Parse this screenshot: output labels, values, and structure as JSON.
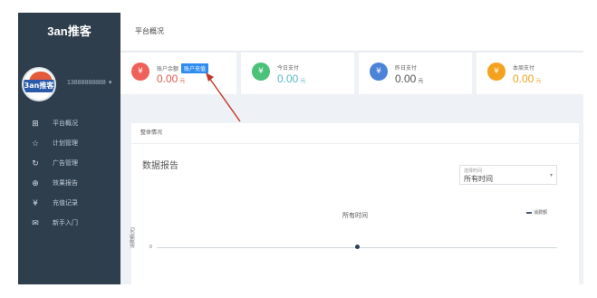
{
  "sidebar": {
    "brand": "3an推客",
    "avatar_text": "3an推客",
    "username": "13888888888",
    "items": [
      {
        "icon": "grid-icon",
        "glyph": "⊞",
        "label": "平台概况"
      },
      {
        "icon": "star-icon",
        "glyph": "☆",
        "label": "计划管理"
      },
      {
        "icon": "refresh-icon",
        "glyph": "↻",
        "label": "广告管理"
      },
      {
        "icon": "globe-icon",
        "glyph": "⊕",
        "label": "效果报告"
      },
      {
        "icon": "wallet-icon",
        "glyph": "¥",
        "label": "充值记录"
      },
      {
        "icon": "mail-icon",
        "glyph": "✉",
        "label": "新手入门"
      }
    ]
  },
  "header": {
    "title": "平台概况"
  },
  "cards": [
    {
      "label": "账户余额",
      "amount": "0.00",
      "unit": "元",
      "color": "#f0605a",
      "amount_color": "#e2594f",
      "icon": "yen-icon",
      "glyph": "¥",
      "button": "账户充值"
    },
    {
      "label": "今日支付",
      "amount": "0.00",
      "unit": "元",
      "color": "#4cc17a",
      "amount_color": "#59b6c8",
      "icon": "yen-icon",
      "glyph": "¥"
    },
    {
      "label": "昨日支付",
      "amount": "0.00",
      "unit": "元",
      "color": "#4a83d8",
      "amount_color": "#555555",
      "icon": "yen-icon",
      "glyph": "¥"
    },
    {
      "label": "本周支付",
      "amount": "0.00",
      "unit": "元",
      "color": "#f4a21d",
      "amount_color": "#f4a21d",
      "icon": "yen-icon",
      "glyph": "¥"
    }
  ],
  "panel": {
    "header": "整体情况",
    "report_title": "数据报告",
    "select": {
      "caption": "选择时间",
      "value": "所有时间"
    },
    "chart_title": "所有时间",
    "legend": "消费额",
    "ylabel": "消费额(元)",
    "ytick": "0"
  },
  "chart_data": {
    "type": "line",
    "title": "所有时间",
    "series": [
      {
        "name": "消费额",
        "values": [
          0
        ]
      }
    ],
    "ylabel": "消费额(元)",
    "yticks": [
      "0"
    ]
  },
  "annotation": {
    "arrow_color": "#c0392b"
  }
}
